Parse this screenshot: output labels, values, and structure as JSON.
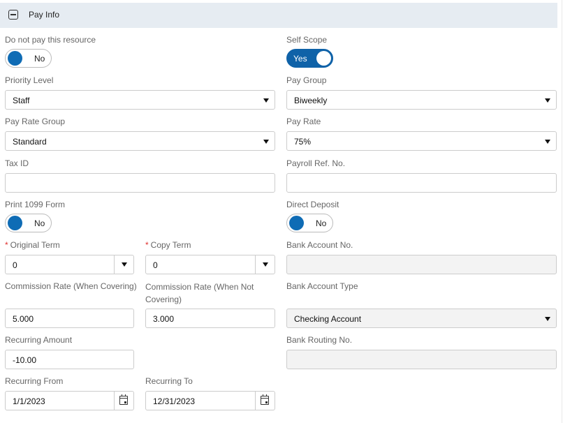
{
  "section": {
    "title": "Pay Info",
    "collapse_icon": "minus-square-icon"
  },
  "toggles": {
    "do_not_pay": {
      "label": "Do not pay this resource",
      "value": "No",
      "on": false
    },
    "self_scope": {
      "label": "Self Scope",
      "value": "Yes",
      "on": true
    },
    "print_1099": {
      "label": "Print 1099 Form",
      "value": "No",
      "on": false
    },
    "direct_deposit": {
      "label": "Direct Deposit",
      "value": "No",
      "on": false
    }
  },
  "fields": {
    "priority_level": {
      "label": "Priority Level",
      "value": "Staff"
    },
    "pay_group": {
      "label": "Pay Group",
      "value": "Biweekly"
    },
    "pay_rate_group": {
      "label": "Pay Rate Group",
      "value": "Standard"
    },
    "pay_rate": {
      "label": "Pay Rate",
      "value": "75%"
    },
    "tax_id": {
      "label": "Tax ID",
      "value": ""
    },
    "payroll_ref_no": {
      "label": "Payroll Ref. No.",
      "value": ""
    },
    "original_term": {
      "label": "Original Term",
      "required_mark": "*",
      "value": "0"
    },
    "copy_term": {
      "label": "Copy Term",
      "required_mark": "*",
      "value": "0"
    },
    "bank_account_no": {
      "label": "Bank Account No.",
      "value": ""
    },
    "commission_covering": {
      "label": "Commission Rate (When Covering)",
      "value": "5.000"
    },
    "commission_not_covering": {
      "label": "Commission Rate (When Not Covering)",
      "value": "3.000"
    },
    "bank_account_type": {
      "label": "Bank Account Type",
      "value": "Checking Account"
    },
    "recurring_amount": {
      "label": "Recurring Amount",
      "value": "-10.00"
    },
    "bank_routing_no": {
      "label": "Bank Routing No.",
      "value": ""
    },
    "recurring_from": {
      "label": "Recurring From",
      "value": "1/1/2023"
    },
    "recurring_to": {
      "label": "Recurring To",
      "value": "12/31/2023"
    }
  },
  "colors": {
    "accent": "#0f62a8",
    "header_bg": "#e6ecf2",
    "required": "#e0312f",
    "disabled_bg": "#f3f3f3"
  }
}
